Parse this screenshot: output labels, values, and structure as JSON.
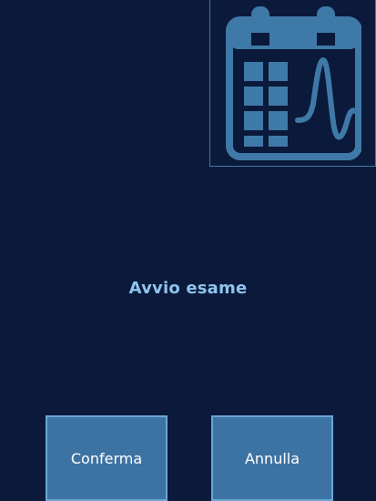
{
  "app_icon": {
    "icon": "calendar-with-waveform-icon",
    "color": "#3f79a8"
  },
  "message": {
    "text": "Avvio esame"
  },
  "buttons": {
    "confirm_label": "Conferma",
    "cancel_label": "Annulla"
  },
  "colors": {
    "background": "#0b1a3a",
    "button_fill": "#3d73a3",
    "button_border": "#6aa6d6",
    "message_text": "#8fc3ee"
  }
}
